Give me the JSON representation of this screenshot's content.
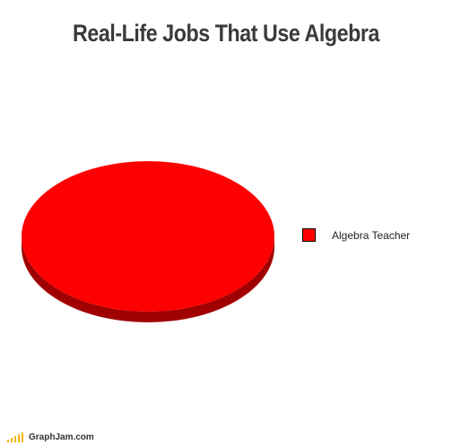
{
  "chart_data": {
    "type": "pie",
    "title": "Real-Life Jobs That Use Algebra",
    "slices": [
      {
        "label": "Algebra Teacher",
        "value": 100,
        "color": "#ff0000",
        "shadow_color": "#a00000"
      }
    ],
    "legend": "right",
    "style": "3d"
  },
  "footer": {
    "site": "GraphJam.com",
    "icon": "bar-chart-logo-icon",
    "icon_color": "#f2b600"
  }
}
